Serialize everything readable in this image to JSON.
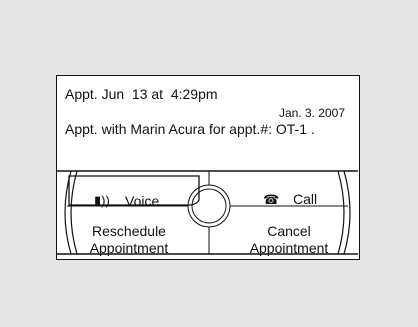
{
  "appointment": {
    "time_line": "Appt. Jun  13 at  4:29pm",
    "date": "Jan. 3. 2007",
    "message": "Appt. with Marin Acura for appt.#: OT-1 ."
  },
  "buttons": {
    "voice": {
      "label": "Voice",
      "icon": "speaker-icon"
    },
    "call": {
      "label": "Call",
      "icon": "phone-icon"
    },
    "reschedule": {
      "label": "Reschedule\nAppointment"
    },
    "cancel": {
      "label": "Cancel\nAppointment"
    }
  },
  "colors": {
    "background": "#e6e6e6",
    "screen": "#ffffff",
    "stroke": "#111111"
  }
}
